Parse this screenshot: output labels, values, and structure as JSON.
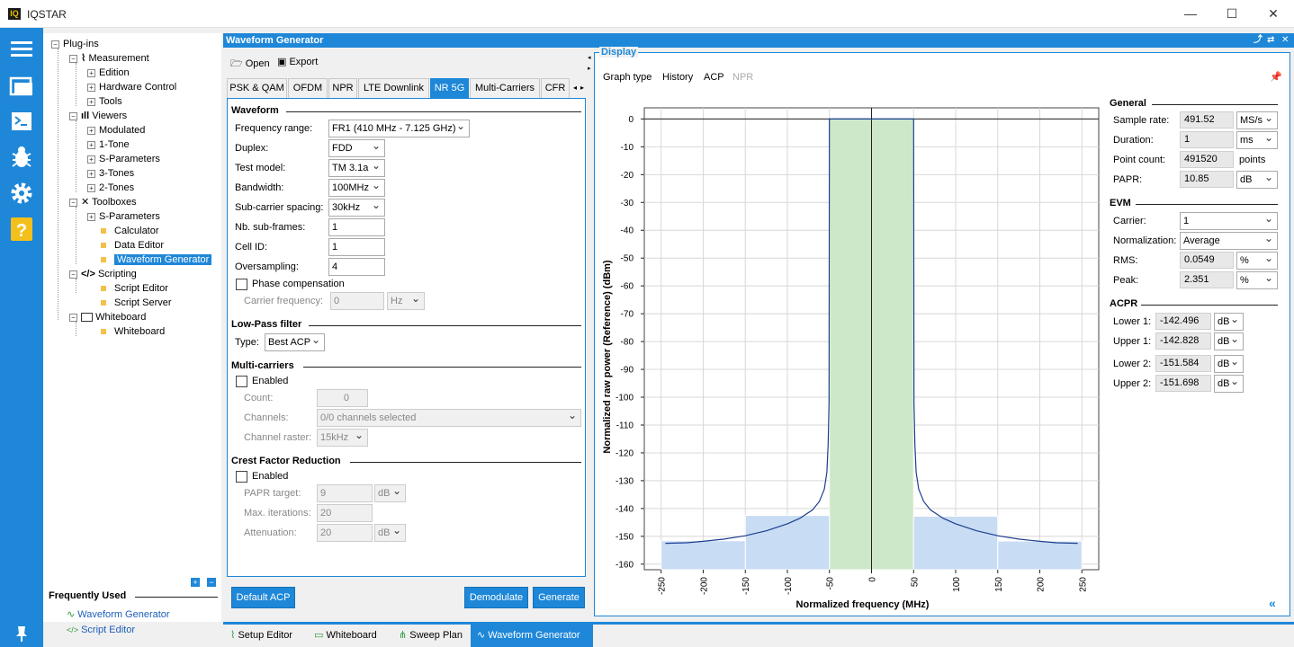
{
  "app": {
    "title": "IQSTAR",
    "logo_text": "IQ",
    "minimize": "—",
    "maximize": "☐",
    "close": "✕"
  },
  "tree": {
    "root": "Plug-ins",
    "measurement": "Measurement",
    "edition": "Edition",
    "hardware_control": "Hardware Control",
    "tools": "Tools",
    "viewers": "Viewers",
    "modulated": "Modulated",
    "one_tone": "1-Tone",
    "s_parameters_v": "S-Parameters",
    "three_tones": "3-Tones",
    "two_tones": "2-Tones",
    "toolboxes": "Toolboxes",
    "s_parameters_t": "S-Parameters",
    "calculator": "Calculator",
    "data_editor": "Data Editor",
    "waveform_generator": "Waveform Generator",
    "scripting": "Scripting",
    "script_editor": "Script Editor",
    "script_server": "Script Server",
    "whiteboard": "Whiteboard",
    "whiteboard_leaf": "Whiteboard"
  },
  "frequently_used": {
    "title": "Frequently Used",
    "items": [
      "Waveform Generator",
      "Script Editor"
    ]
  },
  "main": {
    "title": "Waveform Generator",
    "open": "Open",
    "export": "Export",
    "tabs": [
      "PSK & QAM",
      "OFDM",
      "NPR",
      "LTE Downlink",
      "NR 5G",
      "Multi-Carriers",
      "CFR"
    ],
    "active_tab": "NR 5G"
  },
  "waveform": {
    "title": "Waveform",
    "frequency_range_label": "Frequency range:",
    "frequency_range": "FR1 (410 MHz - 7.125 GHz)",
    "duplex_label": "Duplex:",
    "duplex": "FDD",
    "test_model_label": "Test model:",
    "test_model": "TM 3.1a",
    "bandwidth_label": "Bandwidth:",
    "bandwidth": "100MHz",
    "scs_label": "Sub-carrier spacing:",
    "scs": "30kHz",
    "subframes_label": "Nb. sub-frames:",
    "subframes": "1",
    "cell_id_label": "Cell ID:",
    "cell_id": "1",
    "oversampling_label": "Oversampling:",
    "oversampling": "4",
    "phase_comp_label": "Phase compensation",
    "carrier_freq_label": "Carrier frequency:",
    "carrier_freq": "0",
    "carrier_freq_unit": "Hz"
  },
  "lowpass": {
    "title": "Low-Pass filter",
    "type_label": "Type:",
    "type": "Best ACP"
  },
  "multicarriers": {
    "title": "Multi-carriers",
    "enabled_label": "Enabled",
    "count_label": "Count:",
    "count": "0",
    "channels_label": "Channels:",
    "channels": "0/0 channels selected",
    "raster_label": "Channel raster:",
    "raster": "15kHz"
  },
  "cfr": {
    "title": "Crest Factor Reduction",
    "enabled_label": "Enabled",
    "papr_target_label": "PAPR target:",
    "papr_target": "9",
    "papr_unit": "dB",
    "max_iter_label": "Max. iterations:",
    "max_iter": "20",
    "attenuation_label": "Attenuation:",
    "attenuation": "20",
    "attenuation_unit": "dB"
  },
  "buttons": {
    "default_acp": "Default ACP",
    "demodulate": "Demodulate",
    "generate": "Generate"
  },
  "display": {
    "title": "Display",
    "menu": [
      "Graph type",
      "History",
      "ACP",
      "NPR"
    ]
  },
  "general": {
    "title": "General",
    "sample_rate_label": "Sample rate:",
    "sample_rate": "491.52",
    "sample_rate_unit": "MS/s",
    "duration_label": "Duration:",
    "duration": "1",
    "duration_unit": "ms",
    "point_count_label": "Point count:",
    "point_count": "491520",
    "point_count_unit": "points",
    "papr_label": "PAPR:",
    "papr": "10.85",
    "papr_unit": "dB"
  },
  "evm": {
    "title": "EVM",
    "carrier_label": "Carrier:",
    "carrier": "1",
    "normalization_label": "Normalization:",
    "normalization": "Average",
    "rms_label": "RMS:",
    "rms": "0.0549",
    "rms_unit": "%",
    "peak_label": "Peak:",
    "peak": "2.351",
    "peak_unit": "%"
  },
  "acpr": {
    "title": "ACPR",
    "lower1_label": "Lower 1:",
    "lower1": "-142.496",
    "lower1_unit": "dB",
    "upper1_label": "Upper 1:",
    "upper1": "-142.828",
    "upper1_unit": "dB",
    "lower2_label": "Lower 2:",
    "lower2": "-151.584",
    "lower2_unit": "dB",
    "upper2_label": "Upper 2:",
    "upper2": "-151.698",
    "upper2_unit": "dB"
  },
  "bottom_tabs": [
    "Setup Editor",
    "Whiteboard",
    "Sweep Plan",
    "Waveform Generator"
  ],
  "colors": {
    "accent": "#1e87d8",
    "main_band": "#cde8c8",
    "adjacent_band": "#c8dcf4",
    "trace": "#1c3f8f"
  },
  "chart_data": {
    "type": "line",
    "xlabel": "Normalized frequency (MHz)",
    "ylabel": "Normalized raw power (Reference) (dBm)",
    "xlim": [
      -270,
      270
    ],
    "ylim": [
      -162,
      4
    ],
    "xticks": [
      -250,
      -200,
      -150,
      -100,
      -50,
      0,
      50,
      100,
      150,
      200,
      250
    ],
    "yticks": [
      0,
      -10,
      -20,
      -30,
      -40,
      -50,
      -60,
      -70,
      -80,
      -90,
      -100,
      -110,
      -120,
      -130,
      -140,
      -150,
      -160
    ],
    "grid": true,
    "bands": [
      {
        "x0": -50,
        "x1": 50,
        "top": 0,
        "kind": "main"
      },
      {
        "x0": -150,
        "x1": -50,
        "top": -142.5,
        "kind": "adjacent"
      },
      {
        "x0": 50,
        "x1": 150,
        "top": -142.8,
        "kind": "adjacent"
      },
      {
        "x0": -250,
        "x1": -150,
        "top": -151.6,
        "kind": "adjacent"
      },
      {
        "x0": 150,
        "x1": 250,
        "top": -151.7,
        "kind": "adjacent"
      }
    ],
    "series": [
      {
        "x": [
          -245,
          -220,
          -200,
          -175,
          -150,
          -125,
          -100,
          -85,
          -70,
          -62,
          -56,
          -53,
          -51.5,
          -50.5,
          -50,
          50,
          50.5,
          51.5,
          53,
          56,
          62,
          70,
          85,
          100,
          125,
          150,
          175,
          200,
          220,
          245
        ],
        "y": [
          -152.5,
          -152.3,
          -151.8,
          -151,
          -149.8,
          -148,
          -145.5,
          -143.5,
          -140.5,
          -137.5,
          -133,
          -127,
          -117,
          -102,
          0,
          0,
          -102,
          -117,
          -127,
          -133,
          -137.5,
          -140.5,
          -143.5,
          -145.5,
          -148,
          -149.8,
          -151,
          -151.8,
          -152.3,
          -152.5
        ]
      }
    ]
  }
}
